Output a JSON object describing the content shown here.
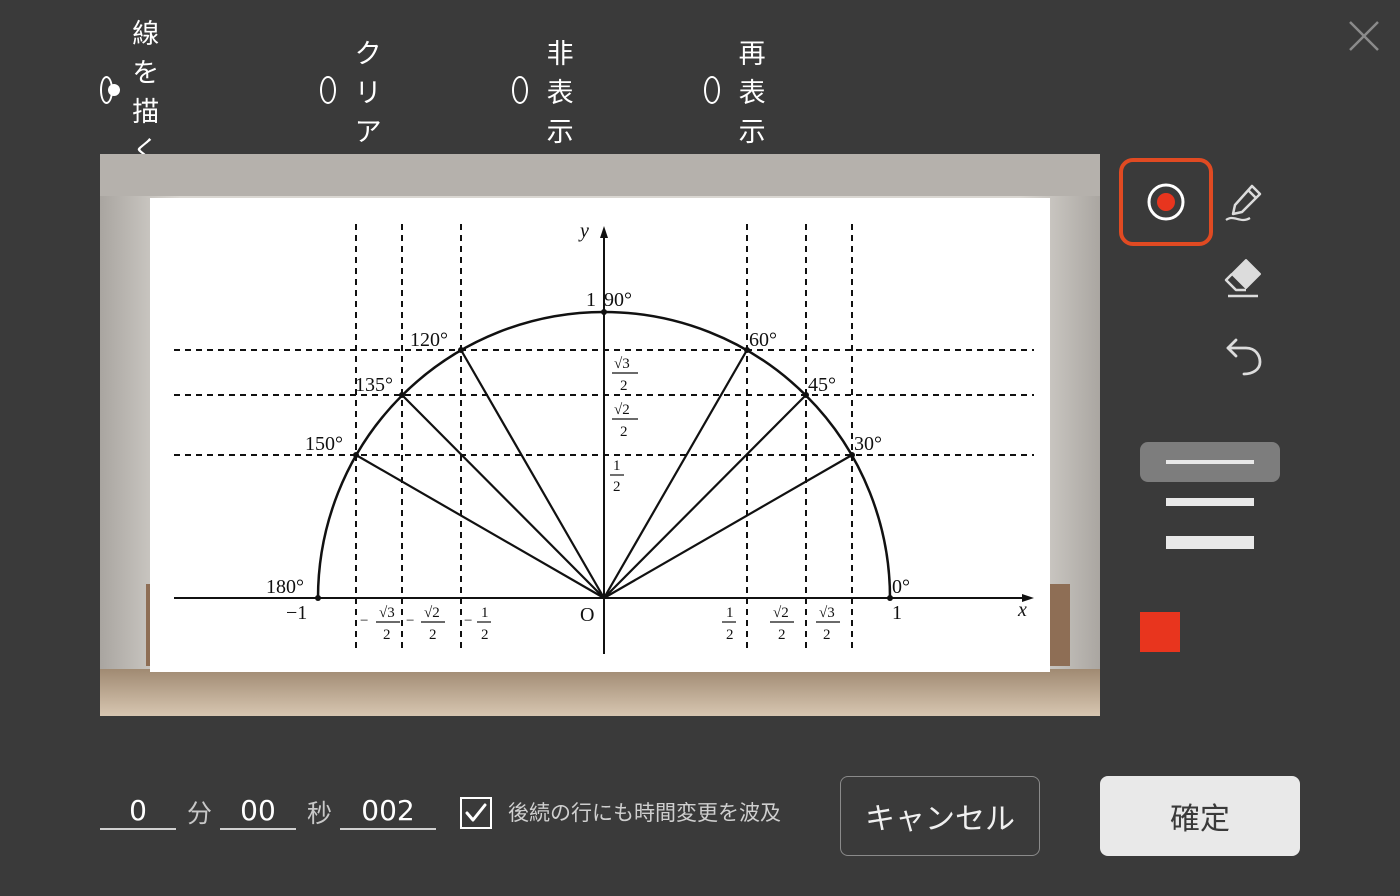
{
  "modes": [
    {
      "label": "線を描く",
      "selected": true
    },
    {
      "label": "クリア",
      "selected": false
    },
    {
      "label": "非表示",
      "selected": false
    },
    {
      "label": "再表示",
      "selected": false
    }
  ],
  "tools": {
    "record": "record-icon",
    "pen": "pen-icon",
    "eraser": "eraser-icon",
    "undo": "undo-icon",
    "selected": "record"
  },
  "line_widths": {
    "options": [
      "thin",
      "medium",
      "thick"
    ],
    "selected": "thin"
  },
  "pen_color": "#e8351e",
  "accent_color": "#e04a22",
  "figure": {
    "y_axis": "y",
    "x_axis": "x",
    "origin": "O",
    "top_value": "1",
    "angles": [
      "90°",
      "120°",
      "60°",
      "135°",
      "45°",
      "150°",
      "30°",
      "180°",
      "0°"
    ],
    "neg_one": "−1",
    "one": "1",
    "half": "1",
    "denominator": "2",
    "sqrt3": "√3",
    "sqrt2": "√2",
    "minus": "−"
  },
  "time": {
    "minutes": "0",
    "minutes_unit": "分",
    "seconds": "00",
    "seconds_unit": "秒",
    "fraction": "002"
  },
  "cascade_checkbox": {
    "label": "後続の行にも時間変更を波及",
    "checked": true
  },
  "buttons": {
    "cancel": "キャンセル",
    "confirm": "確定"
  }
}
